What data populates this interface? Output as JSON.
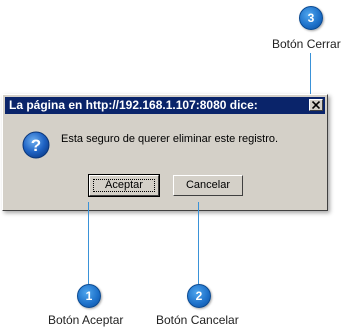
{
  "callouts": [
    {
      "number": "3",
      "label": "Botón Cerrar"
    },
    {
      "number": "1",
      "label": "Botón Aceptar"
    },
    {
      "number": "2",
      "label": "Botón Cancelar"
    }
  ],
  "dialog": {
    "title": "La página en http://192.168.1.107:8080 dice:",
    "message": "Esta seguro de querer eliminar este registro.",
    "icon": "question-icon",
    "buttons": {
      "accept_label": "Aceptar",
      "cancel_label": "Cancelar"
    }
  },
  "colors": {
    "titlebar": "#0a246a",
    "dialog_face": "#d4d0c8",
    "callout_blue": "#1c6fc8"
  }
}
